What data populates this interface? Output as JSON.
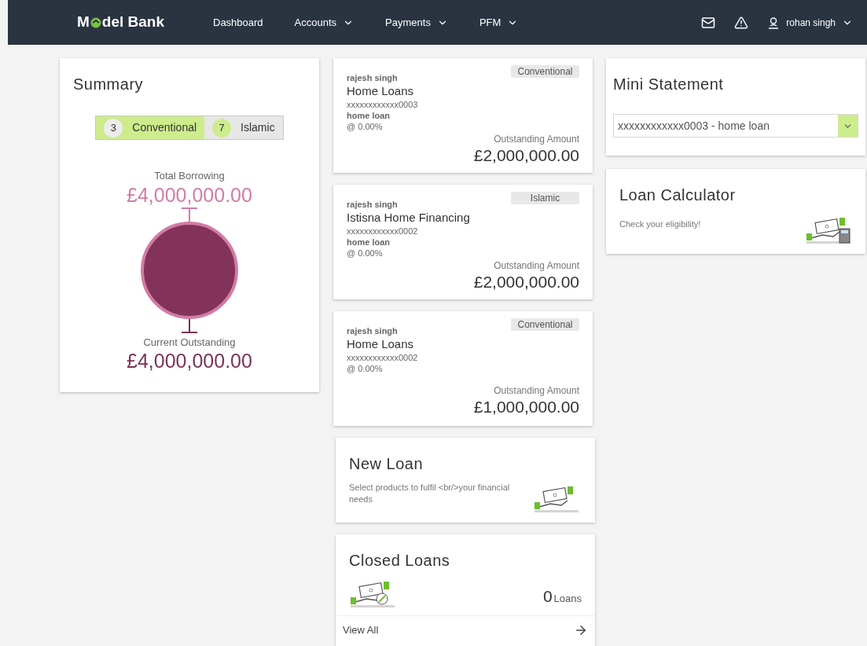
{
  "brand": {
    "name_before": "M",
    "name_after": "del Bank"
  },
  "nav": [
    {
      "label": "Dashboard",
      "has_menu": false
    },
    {
      "label": "Accounts",
      "has_menu": true
    },
    {
      "label": "Payments",
      "has_menu": true
    },
    {
      "label": "PFM",
      "has_menu": true
    }
  ],
  "user": {
    "name": "rohan singh"
  },
  "summary": {
    "title": "Summary",
    "tabs": [
      {
        "count": "3",
        "label": "Conventional",
        "selected": true
      },
      {
        "count": "7",
        "label": "Islamic",
        "selected": false
      }
    ],
    "total_label": "Total Borrowing",
    "total": "£4,000,000.00",
    "outstanding_label": "Current Outstanding",
    "outstanding": "£4,000,000.00"
  },
  "loans": [
    {
      "holder": "rajesh singh",
      "product": "Home Loans",
      "account": "xxxxxxxxxxxx0003",
      "type": "home loan",
      "rate": "@ 0.00%",
      "category": "Conventional",
      "amount_label": "Outstanding Amount",
      "amount": "£2,000,000.00"
    },
    {
      "holder": "rajesh singh",
      "product": "Istisna Home Financing",
      "account": "xxxxxxxxxxxx0002",
      "type": "home loan",
      "rate": "@ 0.00%",
      "category": "Islamic",
      "amount_label": "Outstanding Amount",
      "amount": "£2,000,000.00"
    },
    {
      "holder": "rajesh singh",
      "product": "Home Loans",
      "account": "xxxxxxxxxxxx0002",
      "rate": "@ 0.00%",
      "category": "Conventional",
      "amount_label": "Outstanding Amount",
      "amount": "£1,000,000.00"
    }
  ],
  "new_loan": {
    "title": "New Loan",
    "text": "Select products to fulfil <br/>your financial needs"
  },
  "closed_loans": {
    "title": "Closed Loans",
    "count": "0",
    "unit": "Loans",
    "link": "View All"
  },
  "mini_statement": {
    "title": "Mini Statement",
    "selected_account": "xxxxxxxxxxxx0003 - home loan"
  },
  "loan_calculator": {
    "title": "Loan Calculator",
    "text": "Check your eligibility!"
  }
}
